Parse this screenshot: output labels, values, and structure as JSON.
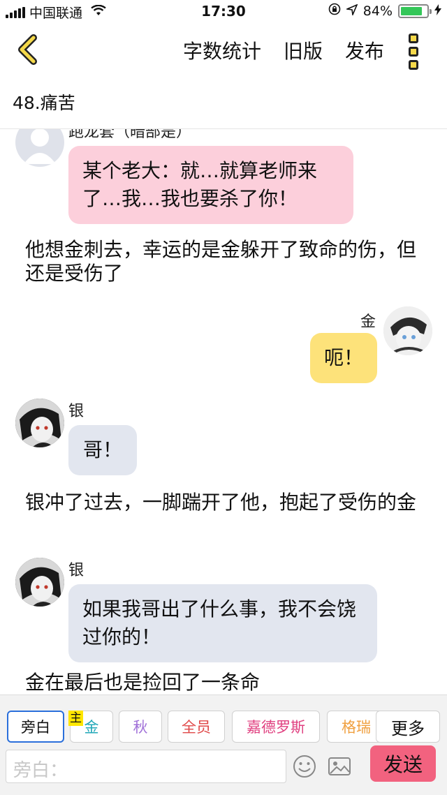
{
  "status_bar": {
    "carrier": "中国联通",
    "time": "17:30",
    "battery": "84%",
    "battery_level": 0.84
  },
  "nav": {
    "actions": [
      "字数统计",
      "旧版",
      "发布"
    ]
  },
  "chapter_title": "48.痛苦",
  "messages": {
    "m0_name": "跑龙套（暗部是）",
    "m0_text": "某个老大：就…就算老师来了…我…我也要杀了你！",
    "n1": "他想金刺去，幸运的是金躲开了致命的伤，但还是受伤了",
    "m2_name": "金",
    "m2_text": "呃！",
    "m3_name": "银",
    "m3_text": "哥！",
    "n4": "银冲了过去，一脚踹开了他，抱起了受伤的金",
    "m5_name": "银",
    "m5_text": "如果我哥出了什么事，我不会饶过你的！",
    "n6": "金在最后也是捡回了一条命"
  },
  "roles": {
    "narrator": "旁白",
    "main_tag": "主",
    "jin": "金",
    "qiu": "秋",
    "all": "全员",
    "jiade": "嘉德罗斯",
    "gerui": "格瑞",
    "more": "更多"
  },
  "input": {
    "placeholder": "旁白："
  },
  "send_label": "发送",
  "colors": {
    "pink_bubble": "#fccfdb",
    "yellow_bubble": "#fde27a",
    "blue_bubble": "#e2e6ef",
    "send": "#f2627f",
    "accent_back": "#f5d94a"
  }
}
